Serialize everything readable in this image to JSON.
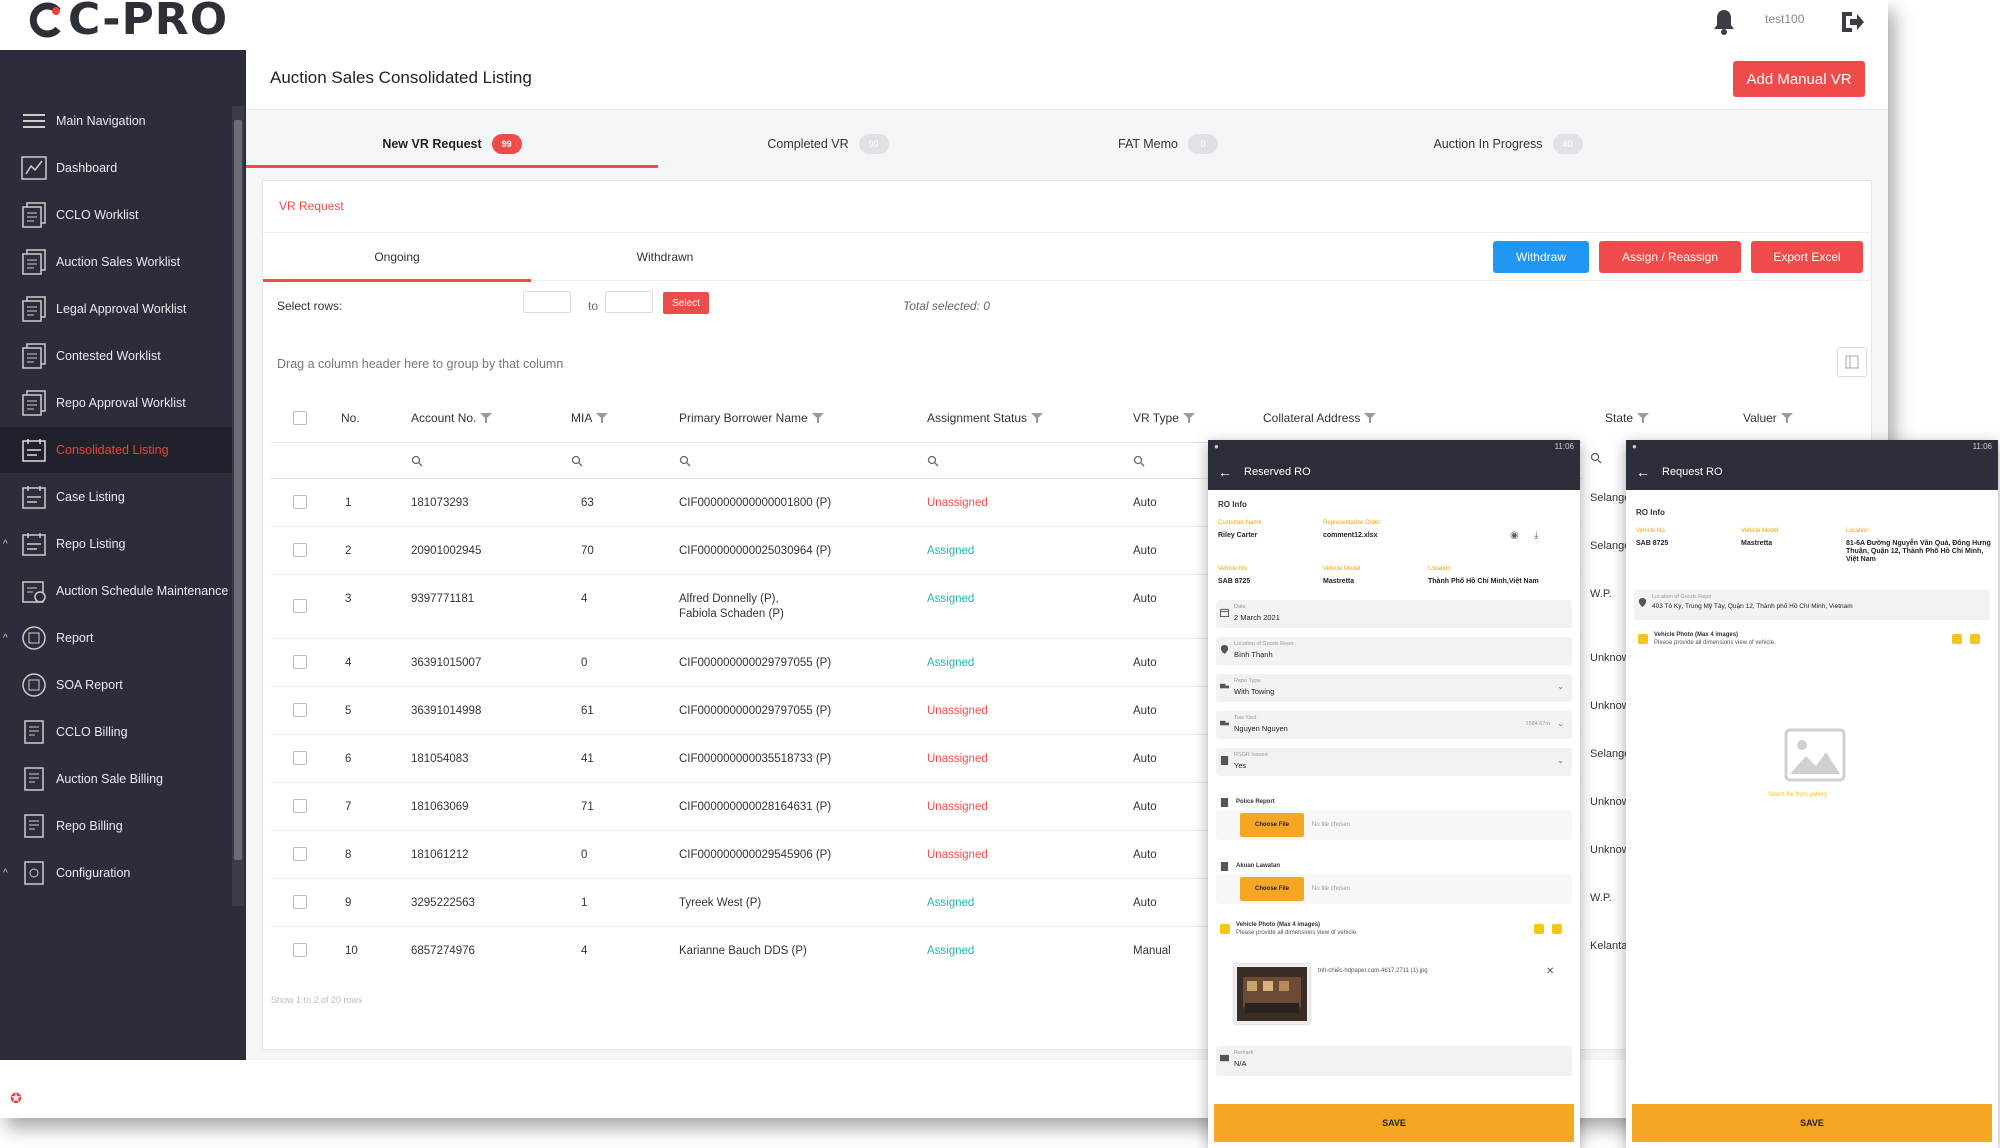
{
  "app": {
    "logo": "C-PRO",
    "username": "test100"
  },
  "sidebar": {
    "items": [
      {
        "label": "Main Navigation",
        "icon": "hamburger-icon"
      },
      {
        "label": "Dashboard",
        "icon": "dashboard-icon"
      },
      {
        "label": "CCLO Worklist",
        "icon": "worklist-icon"
      },
      {
        "label": "Auction Sales Worklist",
        "icon": "worklist-icon"
      },
      {
        "label": "Legal Approval Worklist",
        "icon": "worklist-icon"
      },
      {
        "label": "Contested Worklist",
        "icon": "worklist-icon"
      },
      {
        "label": "Repo Approval Worklist",
        "icon": "worklist-icon"
      },
      {
        "label": "Consolidated Listing",
        "icon": "listing-icon"
      },
      {
        "label": "Case Listing",
        "icon": "listing-icon"
      },
      {
        "label": "Repo Listing",
        "icon": "listing-icon"
      },
      {
        "label": "Auction Schedule Maintenance",
        "icon": "schedule-icon"
      },
      {
        "label": "Report",
        "icon": "report-icon"
      },
      {
        "label": "SOA Report",
        "icon": "report-icon"
      },
      {
        "label": "CCLO Billing",
        "icon": "billing-icon"
      },
      {
        "label": "Auction Sale Billing",
        "icon": "billing-icon"
      },
      {
        "label": "Repo Billing",
        "icon": "billing-icon"
      },
      {
        "label": "Configuration",
        "icon": "config-icon"
      }
    ]
  },
  "header": {
    "title": "Auction Sales Consolidated Listing",
    "add_button": "Add Manual VR"
  },
  "tabs": [
    {
      "label": "New VR Request",
      "badge": "99"
    },
    {
      "label": "Completed VR",
      "badge": "99"
    },
    {
      "label": "FAT Memo",
      "badge": "0"
    },
    {
      "label": "Auction In Progress",
      "badge": "40"
    }
  ],
  "vr": {
    "section_label": "VR Request",
    "subtabs": [
      "Ongoing",
      "Withdrawn"
    ],
    "buttons": {
      "withdraw": "Withdraw",
      "assign": "Assign / Reassign",
      "export": "Export Excel"
    },
    "select_rows_label": "Select rows:",
    "to_label": "to",
    "select_button": "Select",
    "total_selected": "Total selected: 0",
    "group_hint": "Drag a column header here to group by that column",
    "footer": "Show 1 to 2 of 20 rows"
  },
  "table": {
    "columns": [
      "No.",
      "Account No.",
      "MIA",
      "Primary Borrower Name",
      "Assignment Status",
      "VR Type",
      "Collateral Address",
      "State",
      "Valuer"
    ],
    "rows": [
      {
        "no": "1",
        "account": "181073293",
        "mia": "63",
        "borrower": "CIF000000000000001800 (P)",
        "status": "Unassigned",
        "vrtype": "Auto",
        "state": "Selangor"
      },
      {
        "no": "2",
        "account": "20901002945",
        "mia": "70",
        "borrower": "CIF000000000025030964 (P)",
        "status": "Assigned",
        "vrtype": "Auto",
        "state": "Selangor"
      },
      {
        "no": "3",
        "account": "9397771181",
        "mia": "4",
        "borrower": "Alfred Donnelly (P),",
        "borrower2": "Fabiola Schaden (P)",
        "status": "Assigned",
        "vrtype": "Auto",
        "state": "W.P."
      },
      {
        "no": "4",
        "account": "36391015007",
        "mia": "0",
        "borrower": "CIF000000000029797055 (P)",
        "status": "Assigned",
        "vrtype": "Auto",
        "state": "Unknown"
      },
      {
        "no": "5",
        "account": "36391014998",
        "mia": "61",
        "borrower": "CIF000000000029797055 (P)",
        "status": "Unassigned",
        "vrtype": "Auto",
        "state": "Unknown"
      },
      {
        "no": "6",
        "account": "181054083",
        "mia": "41",
        "borrower": "CIF000000000035518733 (P)",
        "status": "Unassigned",
        "vrtype": "Auto",
        "state": "Selangor"
      },
      {
        "no": "7",
        "account": "181063069",
        "mia": "71",
        "borrower": "CIF000000000028164631 (P)",
        "status": "Unassigned",
        "vrtype": "Auto",
        "state": "Unknown"
      },
      {
        "no": "8",
        "account": "181061212",
        "mia": "0",
        "borrower": "CIF000000000029545906 (P)",
        "status": "Unassigned",
        "vrtype": "Auto",
        "state": "Unknown"
      },
      {
        "no": "9",
        "account": "3295222563",
        "mia": "1",
        "borrower": "Tyreek West (P)",
        "status": "Assigned",
        "vrtype": "Auto",
        "state": "W.P."
      },
      {
        "no": "10",
        "account": "6857274976",
        "mia": "4",
        "borrower": "Karianne Bauch DDS (P)",
        "status": "Assigned",
        "vrtype": "Manual",
        "state": "Kelantan"
      }
    ]
  },
  "phone1": {
    "status_time": "11:06",
    "title": "Reserved RO",
    "section": "RO Info",
    "customer_label": "Customer Name",
    "customer": "Riley Carter",
    "rep_label": "Representative Order",
    "rep": "comment12.xlsx",
    "vehicle_label": "Vehicle No.",
    "vehicle": "SAB 8725",
    "model_label": "Vehicle Model",
    "model": "Mastretta",
    "location_label": "Location",
    "location": "Thành Phố Hồ Chí Minh,Việt Nam",
    "fields": [
      {
        "label": "Date",
        "value": "2 March 2021"
      },
      {
        "label": "Location of Goods Repo",
        "value": "Bình Thạnh"
      },
      {
        "label": "Repo Type",
        "value": "With Towing"
      },
      {
        "label": "Tow Yard",
        "value": "Nguyen Nguyen",
        "extra": "1584.67m"
      },
      {
        "label": "RSGR Issued",
        "value": "Yes"
      }
    ],
    "police_label": "Police Report",
    "choose_file": "Choose File",
    "no_file": "No file chosen",
    "akuan_label": "Akuan Lawatan",
    "photo_label": "Vehicle Photo (Max 4 images)",
    "photo_hint": "Please provide all dimensions view of vehicle.",
    "photo_file": "tnh-chiếc-hdpaper.com-4617.2711 (1).jpg",
    "remark_label": "Remark",
    "remark": "N/A",
    "save": "SAVE"
  },
  "phone2": {
    "status_time": "11:06",
    "title": "Request RO",
    "section": "RO Info",
    "vehicle_label": "Vehicle No.",
    "vehicle": "SAB 8725",
    "model_label": "Vehicle Model",
    "model": "Mastretta",
    "location_label": "Location",
    "location": "81-6A Đường Nguyễn Văn Quá, Đông Hưng Thuận, Quận 12, Thành Phố Hồ Chí Minh, Việt Nam",
    "goods_label": "Location of Goods Repo",
    "goods": "403 Tô Ký, Trung Mỹ Tây, Quận 12, Thành phố Hồ Chí Minh, Vietnam",
    "photo_label": "Vehicle Photo (Max 4 images)",
    "photo_hint": "Please provide all dimensions view of vehicle.",
    "gallery": "Select file from gallery",
    "save": "SAVE"
  },
  "colors": {
    "accent": "#ef4b4b",
    "assigned": "#1fb7b3",
    "sidebar": "#2b2e3a",
    "phone_accent": "#f5a623"
  }
}
